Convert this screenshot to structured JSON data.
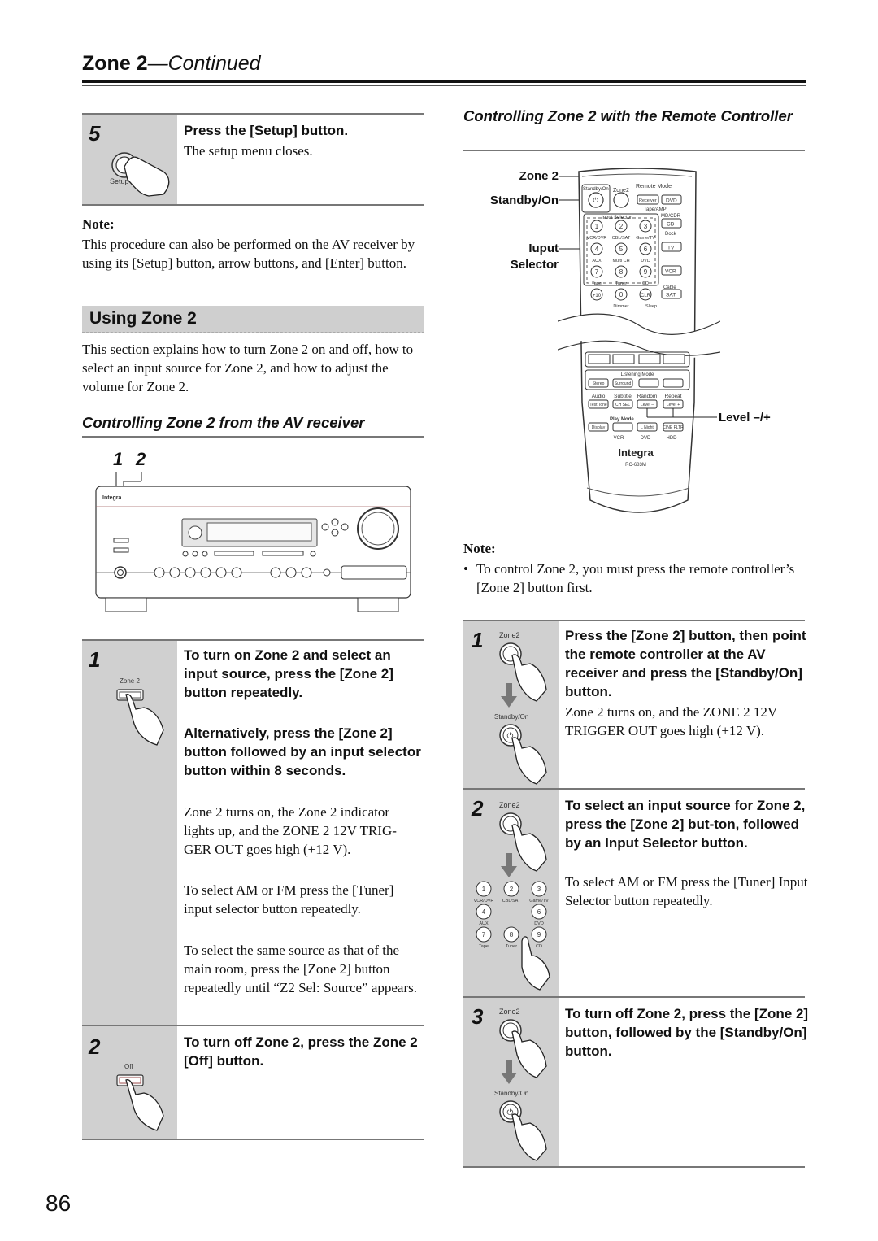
{
  "header": {
    "title": "Zone 2",
    "title_suffix": "—Continued"
  },
  "setup_step": {
    "number": "5",
    "icon_label": "Setup",
    "instruction": "Press the [Setup] button.",
    "result": "The setup menu closes."
  },
  "note_setup": {
    "label": "Note:",
    "text": "This procedure can also be performed on the AV receiver by using its [Setup] button, arrow buttons, and [Enter] button."
  },
  "using_zone2": {
    "heading": "Using Zone 2",
    "intro": "This section explains how to turn Zone 2 on and off, how to select an input source for Zone 2, and how to adjust the volume for Zone 2."
  },
  "av_receiver": {
    "heading": "Controlling Zone 2 from the AV receiver",
    "diagram_callouts": [
      "1",
      "2"
    ],
    "brand": "Integra",
    "steps": [
      {
        "number": "1",
        "icon_label": "Zone 2",
        "instruction": "To turn on Zone 2 and select an input source, press the [Zone 2] button repeatedly.",
        "instruction_alt": "Alternatively, press the [Zone 2] button followed by an input selector button within 8 seconds.",
        "paragraphs": [
          "Zone 2 turns on, the Zone 2 indicator lights up, and the ZONE 2 12V TRIG-GER OUT goes high (+12 V).",
          "To select AM or FM press the [Tuner] input selector button repeatedly.",
          "To select the same source as that of the main room, press the [Zone 2] button repeatedly until “Z2 Sel: Source” appears."
        ]
      },
      {
        "number": "2",
        "icon_label": "Off",
        "instruction": "To turn off Zone 2, press the Zone 2 [Off] button."
      }
    ]
  },
  "remote": {
    "heading": "Controlling Zone 2 with the Remote Controller",
    "callouts": {
      "zone2": "Zone 2",
      "standby": "Standby/On",
      "input_1": "Iuput",
      "input_2": "Selector",
      "level": "Level –/+"
    },
    "remote_labels": {
      "standby": "Standby/On",
      "zone2": "Zone2",
      "remote_mode": "Remote Mode",
      "receiver": "Receiver",
      "dvd": "DVD",
      "tape_amp": "Tape/AMP",
      "md_cdr": "MD/CDR",
      "cd": "CD",
      "dock": "Dock",
      "tv": "TV",
      "vcr": "VCR",
      "cable": "Cable",
      "sat": "SAT",
      "input_selector": "Input Selector",
      "keys": [
        "1",
        "2",
        "3",
        "4",
        "5",
        "6",
        "7",
        "8",
        "9",
        "+10",
        "0",
        "CLR"
      ],
      "key_labels": [
        "VCR/DVR",
        "CBL/SAT",
        "Game/TV",
        "AUX",
        "Multi CH",
        "DVD",
        "Tape",
        "Tuner",
        "CD"
      ],
      "dimmer": "Dimmer",
      "sleep": "Sleep",
      "listening_mode": "Listening Mode",
      "stereo": "Stereo",
      "surround": "Surround",
      "audio": "Audio",
      "subtitle": "Subtitle",
      "random": "Random",
      "repeat": "Repeat",
      "test_tone": "Test Tone",
      "ch_sel": "CH SEL",
      "level_minus": "Level –",
      "level_plus": "Level +",
      "play_mode": "Play Mode",
      "display": "Display",
      "l_night": "L Night",
      "cine_fltr": "CINE FLTR",
      "vcr_dvd_hdd": [
        "VCR",
        "DVD",
        "HDD"
      ],
      "brand": "Integra",
      "model": "RC-683M"
    },
    "note": {
      "label": "Note:",
      "text": "To control Zone 2, you must press the remote controller’s [Zone 2] button first."
    },
    "steps": [
      {
        "number": "1",
        "icon_labels": [
          "Zone2",
          "Standby/On"
        ],
        "instruction": "Press the [Zone 2] button, then point the remote controller at the AV receiver and press the [Standby/On] button.",
        "result": "Zone 2 turns on, and the ZONE 2 12V TRIGGER OUT goes high (+12 V)."
      },
      {
        "number": "2",
        "icon_labels": [
          "Zone2"
        ],
        "keypad": [
          {
            "key": "1",
            "label": "VCR/DVR"
          },
          {
            "key": "2",
            "label": "CBL/SAT"
          },
          {
            "key": "3",
            "label": "Game/TV"
          },
          {
            "key": "4",
            "label": "AUX"
          },
          {
            "key": "6",
            "label": "DVD"
          },
          {
            "key": "7",
            "label": "Tape"
          },
          {
            "key": "8",
            "label": "Tuner"
          },
          {
            "key": "9",
            "label": "CD"
          }
        ],
        "instruction": "To select an input source for Zone 2, press the [Zone 2] but-ton, followed by an Input Selector button.",
        "result": "To select AM or FM press the [Tuner] Input Selector button repeatedly."
      },
      {
        "number": "3",
        "icon_labels": [
          "Zone2",
          "Standby/On"
        ],
        "instruction": "To turn off Zone 2, press the [Zone 2] button, followed by the [Standby/On] button."
      }
    ]
  },
  "page_number": "86"
}
